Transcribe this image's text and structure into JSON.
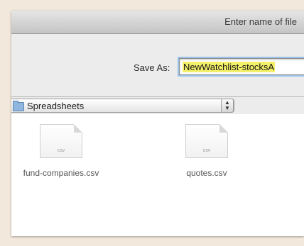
{
  "dialog": {
    "title": "Enter name of file"
  },
  "save_as": {
    "label": "Save As:",
    "value": "NewWatchlist-stocksA"
  },
  "location": {
    "selected": "Spreadsheets",
    "stepper_icon": "up-down-arrows-icon"
  },
  "files": [
    {
      "name": "fund-companies.csv",
      "type": "csv",
      "icon": "csv-document-icon"
    },
    {
      "name": "quotes.csv",
      "type": "csv",
      "icon": "csv-document-icon"
    }
  ],
  "colors": {
    "highlight": "#f4f06a",
    "focus_ring": "#9cc1e8",
    "background": "#f2e9dc"
  }
}
